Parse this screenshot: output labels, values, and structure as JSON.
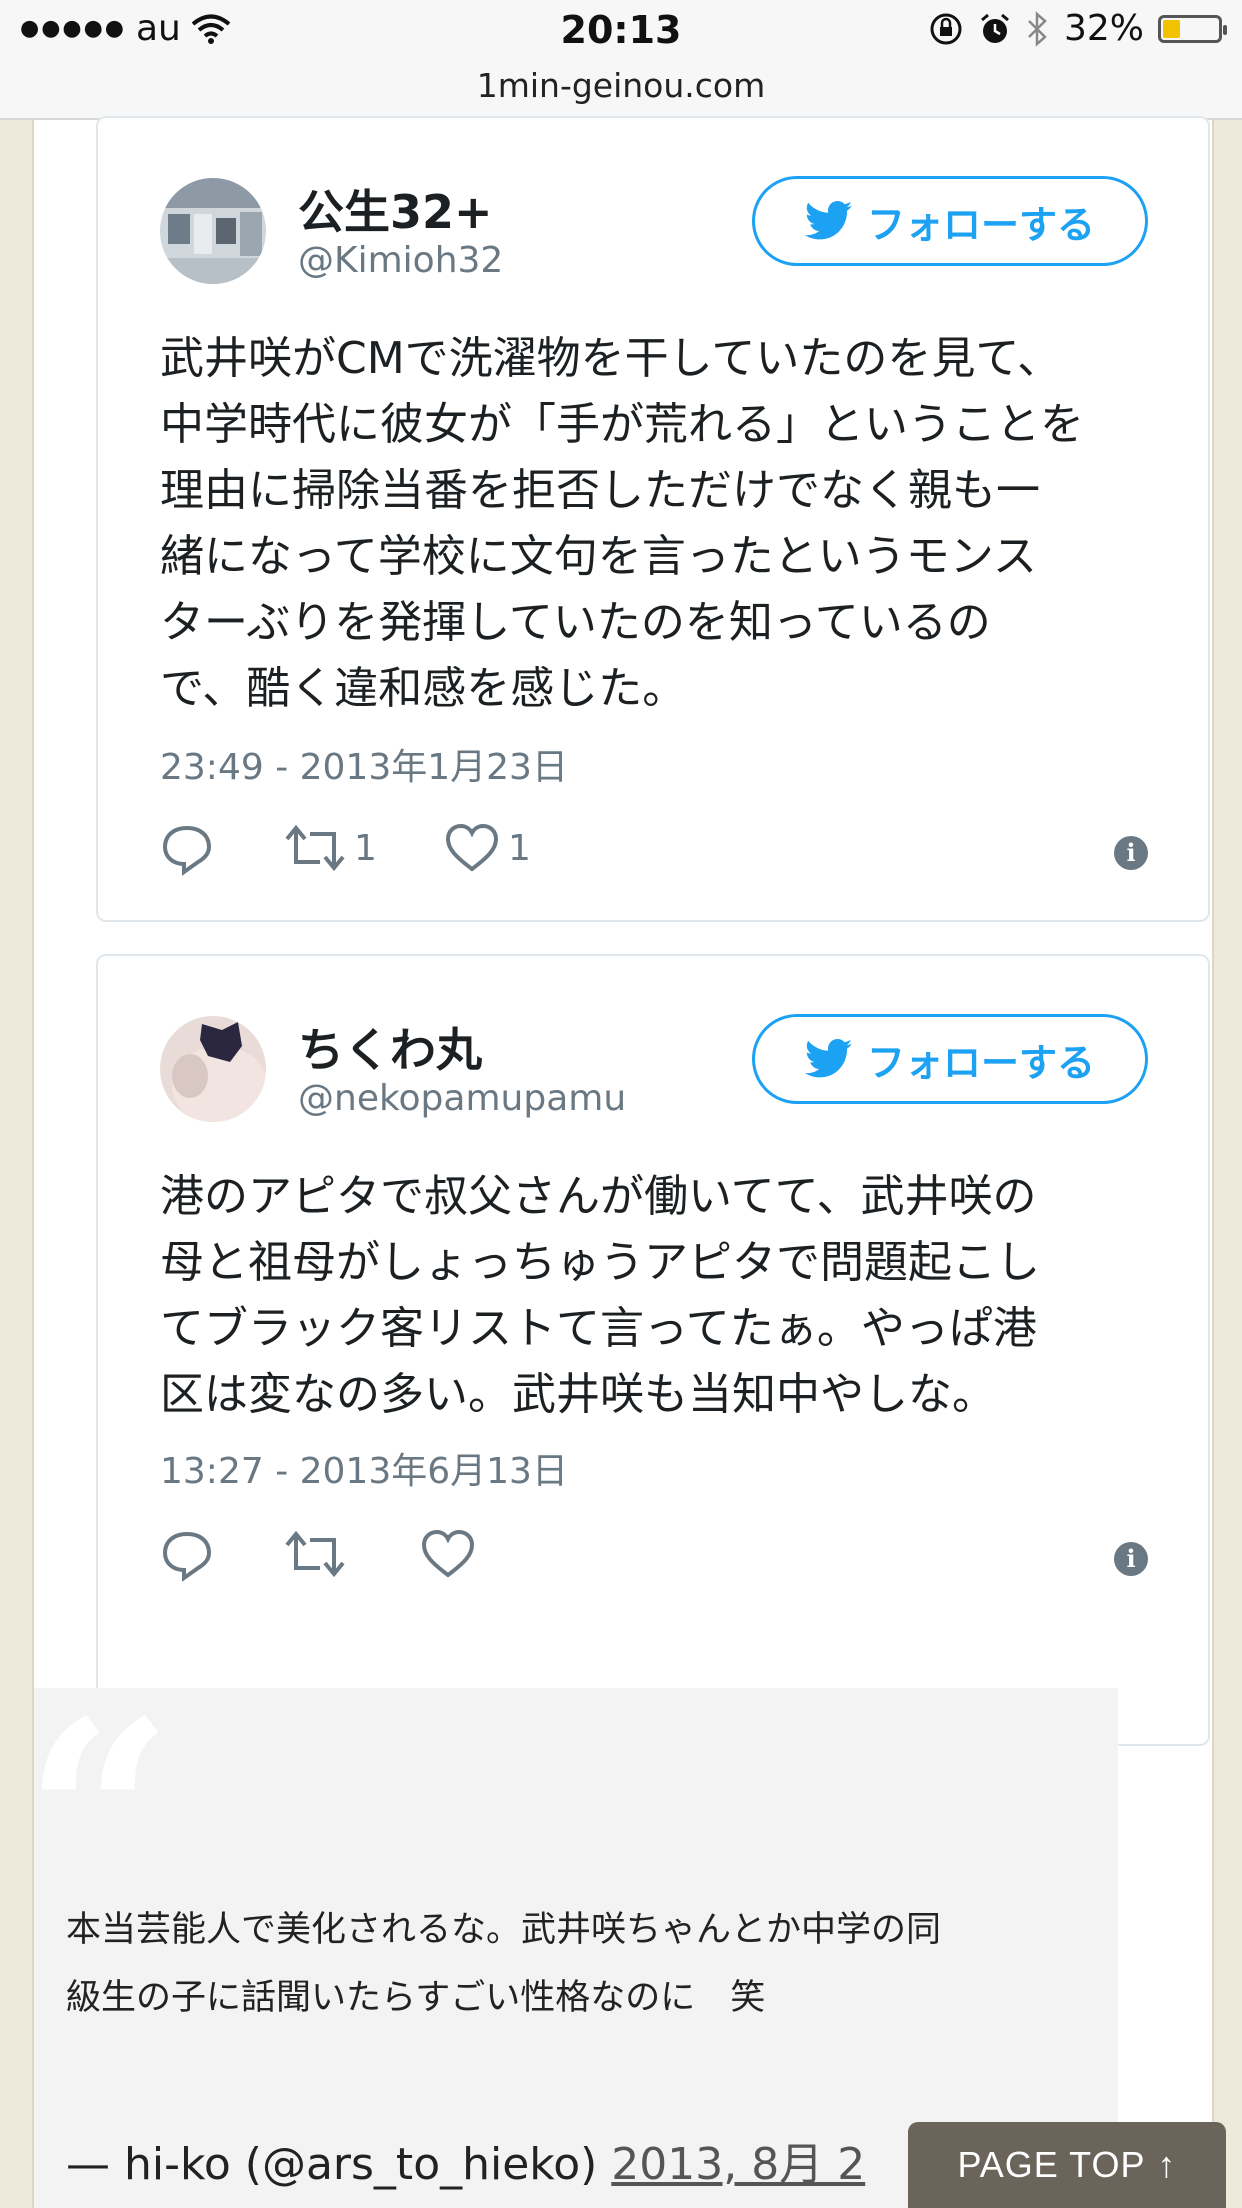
{
  "status_bar": {
    "signal": "●●●●●",
    "carrier": "au",
    "time": "20:13",
    "battery_text": "32%",
    "battery_level": 0.32,
    "battery_color": "#f2c200"
  },
  "browser": {
    "url": "1min-geinou.com"
  },
  "tweets": [
    {
      "name": "公生32+",
      "handle": "@Kimioh32",
      "follow_label": "フォローする",
      "text": "武井咲がCMで洗濯物を干していたのを見て、\n中学時代に彼女が「手が荒れる」ということを\n理由に掃除当番を拒否しただけでなく親も一\n緒になって学校に文句を言ったというモンス\nターぶりを発揮していたのを知っているの\nで、酷く違和感を感じた。",
      "date": "23:49 - 2013年1月23日",
      "retweets": "1",
      "likes": "1",
      "info": "i"
    },
    {
      "name": "ちくわ丸",
      "handle": "@nekopamupamu",
      "follow_label": "フォローする",
      "text": "港のアピタで叔父さんが働いてて、武井咲の\n母と祖母がしょっちゅうアピタで問題起こし\nてブラック客リストて言ってたぁ。やっぱ港\n区は変なの多い。武井咲も当知中やしな。",
      "date": "13:27 - 2013年6月13日",
      "retweets": "",
      "likes": "",
      "info": "i"
    }
  ],
  "quote": {
    "mark": "“",
    "text": "本当芸能人で美化されるな。武井咲ちゃんとか中学の同\n級生の子に話聞いたらすごい性格なのに　笑",
    "author": "— hi-ko (@ars_to_hieko)",
    "date": "2013, 8月 2"
  },
  "page_top": {
    "label": "PAGE TOP",
    "arrow": "↑"
  },
  "colors": {
    "twitter_blue": "#1da1f2",
    "meta_gray": "#697882",
    "page_bg": "#efe9dc"
  },
  "icons": [
    "wifi-icon",
    "lock-rotation-icon",
    "alarm-icon",
    "bluetooth-icon",
    "battery-icon",
    "twitter-bird-icon",
    "reply-icon",
    "retweet-icon",
    "heart-icon",
    "info-icon"
  ]
}
